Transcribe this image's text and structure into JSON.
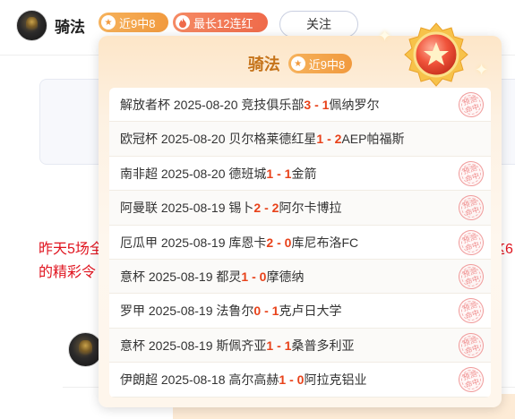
{
  "header": {
    "author_name": "骑法",
    "tag_recent": "近9中8",
    "tag_streak": "最长12连红",
    "follow_label": "关注"
  },
  "background": {
    "text_line1": "昨天5场全",
    "text_line2": "的精彩令",
    "text_right": "这6"
  },
  "popup": {
    "title": "骑法",
    "tag": "近9中8",
    "matches": [
      {
        "league": "解放者杯",
        "date": "2025-08-20",
        "home": "竞技俱乐部",
        "hs": "3",
        "sep": " - ",
        "as": "1",
        "away": "佩纳罗尔",
        "hit": true
      },
      {
        "league": "欧冠杯",
        "date": "2025-08-20",
        "home": "贝尔格莱德红星",
        "hs": "1",
        "sep": " - ",
        "as": "2",
        "away": "AEP帕福斯",
        "hit": false
      },
      {
        "league": "南非超",
        "date": "2025-08-20",
        "home": "德班城",
        "hs": "1",
        "sep": " - ",
        "as": "1",
        "away": "金箭",
        "hit": true
      },
      {
        "league": "阿曼联",
        "date": "2025-08-19",
        "home": "锡卜",
        "hs": "2",
        "sep": " - ",
        "as": "2",
        "away": "阿尔卡博拉",
        "hit": true
      },
      {
        "league": "厄瓜甲",
        "date": "2025-08-19",
        "home": "库恩卡",
        "hs": "2",
        "sep": " - ",
        "as": "0",
        "away": "库尼布洛FC",
        "hit": true
      },
      {
        "league": "意杯",
        "date": "2025-08-19",
        "home": "都灵",
        "hs": "1",
        "sep": " - ",
        "as": "0",
        "away": "摩德纳",
        "hit": true
      },
      {
        "league": "罗甲",
        "date": "2025-08-19",
        "home": "法鲁尔",
        "hs": "0",
        "sep": " - ",
        "as": "1",
        "away": "克卢日大学",
        "hit": true
      },
      {
        "league": "意杯",
        "date": "2025-08-19",
        "home": "斯佩齐亚",
        "hs": "1",
        "sep": " - ",
        "as": "1",
        "away": "桑普多利亚",
        "hit": true
      },
      {
        "league": "伊朗超",
        "date": "2025-08-18",
        "home": "高尔高赫",
        "hs": "1",
        "sep": " - ",
        "as": "0",
        "away": "阿拉克铝业",
        "hit": true
      }
    ],
    "stamp_text": "预测命中"
  },
  "icons": {
    "tag_recent_icon": "star-icon",
    "tag_streak_icon": "flame-icon",
    "medal": "star-medal-icon"
  },
  "colors": {
    "accent_orange": "#f19a3e",
    "score_red": "#e8421a",
    "title_gold": "#c5731a",
    "bg_text_red": "#e0141f"
  }
}
